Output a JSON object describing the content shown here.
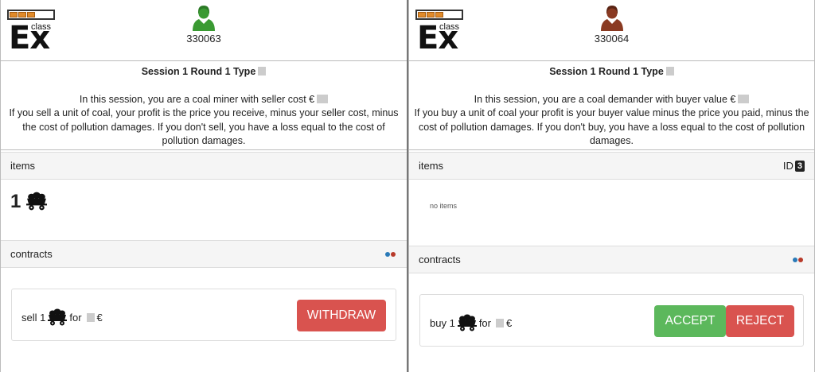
{
  "left": {
    "header": {
      "logo_text": "Ex",
      "logo_sub": "class",
      "user_id": "330063",
      "avatar_color": "#3a9a32"
    },
    "info": {
      "title": "Session 1 Round 1 Type",
      "line1": "In this session, you are a coal miner with seller cost €",
      "line2": "If you sell a unit of coal, your profit is the price you receive, minus your seller cost, minus the cost of pollution damages. If you don't sell, you have a loss equal to the cost of pollution damages."
    },
    "items": {
      "header": "items",
      "count": "1"
    },
    "contracts": {
      "header": "contracts",
      "offer": {
        "verb": "sell 1",
        "for": "for",
        "currency": "€"
      },
      "withdraw_label": "WITHDRAW"
    }
  },
  "right": {
    "header": {
      "logo_text": "Ex",
      "logo_sub": "class",
      "user_id": "330064",
      "avatar_color": "#8a3a22"
    },
    "info": {
      "title": "Session 1 Round 1 Type",
      "line1": "In this session, you are a coal demander with buyer value €",
      "line2": "If you buy a unit of coal your profit is your buyer value minus the price you paid, minus the cost of pollution damages. If you don't buy, you have a loss equal to the cost of pollution damages."
    },
    "items": {
      "header": "items",
      "id_label": "ID",
      "id_value": "3",
      "empty_text": "no items"
    },
    "contracts": {
      "header": "contracts",
      "offer": {
        "verb": "buy 1",
        "for": "for",
        "currency": "€"
      },
      "accept_label": "ACCEPT",
      "reject_label": "REJECT"
    }
  },
  "colors": {
    "withdraw": "#d9534f",
    "accept": "#5cb85c",
    "reject": "#d9534f",
    "dot_blue": "#2a7ab8",
    "dot_red": "#b83a2a"
  },
  "icons": {
    "coal": "coal-cart-icon",
    "user": "user-avatar-icon"
  }
}
